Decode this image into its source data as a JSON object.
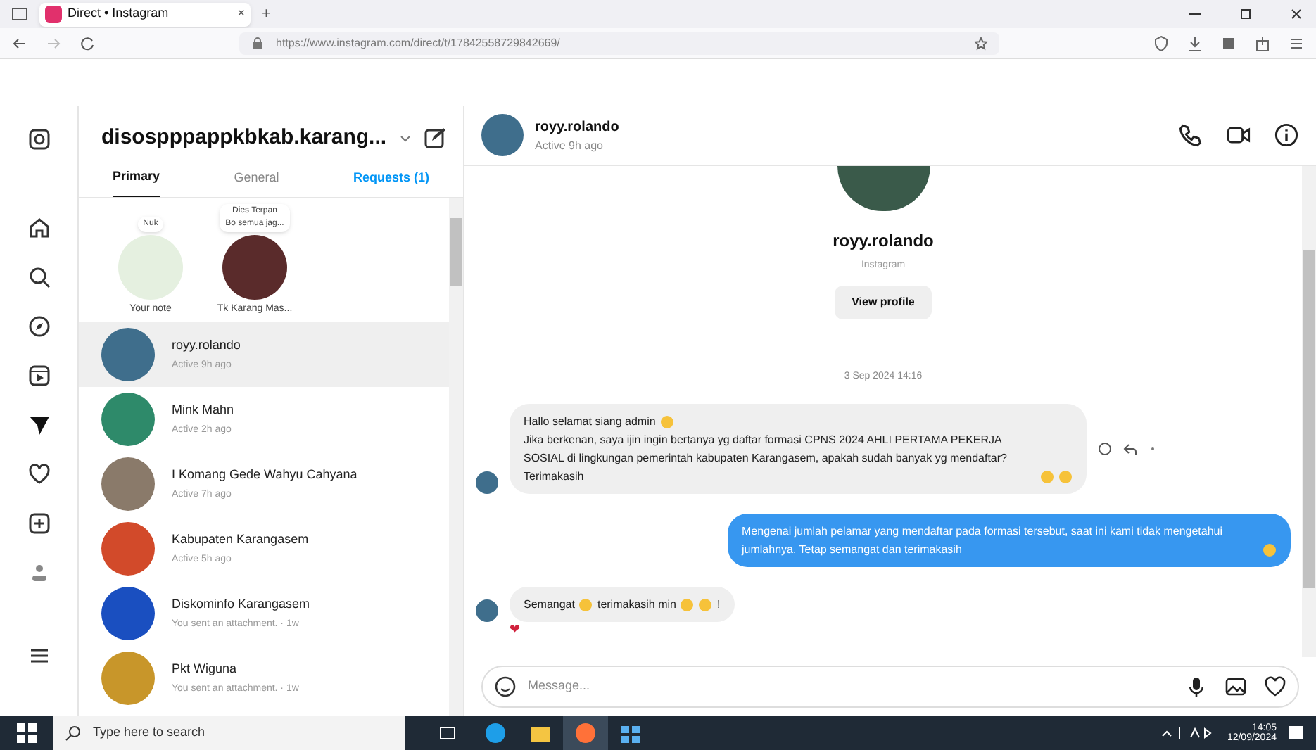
{
  "browser": {
    "tab_title": "Direct • Instagram",
    "tab_close": "×",
    "new_tab": "+",
    "url": "https://www.instagram.com/direct/t/17842558729842669/"
  },
  "account": {
    "username": "disospppappkbkab.karang..."
  },
  "inbox_tabs": [
    {
      "label": "Primary",
      "selected": true,
      "kind": "tab"
    },
    {
      "label": "General",
      "selected": false,
      "kind": "tab"
    },
    {
      "label": "Requests (1)",
      "selected": false,
      "kind": "link"
    }
  ],
  "notes": [
    {
      "label": "Your note",
      "bubble": [
        "Nuk"
      ],
      "color": "#e5f0e0"
    },
    {
      "label": "Tk Karang Mas...",
      "bubble": [
        "Dies Terpan",
        "Bo semua jag..."
      ],
      "color": "#5a2b2b"
    }
  ],
  "threads": [
    {
      "name": "royy.rolando",
      "status": "Active 9h ago",
      "selected": true,
      "color": "#3f6e8c"
    },
    {
      "name": "Mink Mahn",
      "status": "Active 2h ago",
      "selected": false,
      "color": "#2e8a6a"
    },
    {
      "name": "I Komang Gede Wahyu Cahyana",
      "status": "Active 7h ago",
      "selected": false,
      "color": "#8a7a6a"
    },
    {
      "name": "Kabupaten Karangasem",
      "status": "Active 5h ago",
      "selected": false,
      "color": "#d24a2a"
    },
    {
      "name": "Diskominfo Karangasem",
      "status": "You sent an attachment. · 1w",
      "selected": false,
      "color": "#1a4fc0"
    },
    {
      "name": "Pkt Wiguna",
      "status": "You sent an attachment. · 1w",
      "selected": false,
      "color": "#c8962a"
    }
  ],
  "chat": {
    "name": "royy.rolando",
    "status": "Active 9h ago",
    "profile": {
      "name": "royy.rolando",
      "subtitle": "Instagram",
      "button": "View profile"
    },
    "date": "3 Sep 2024 14:16",
    "messages": [
      {
        "kind": "incoming",
        "lines": [
          [
            {
              "kind": "text",
              "text": "Hallo selamat siang admin"
            },
            {
              "kind": "emoji"
            }
          ],
          [
            {
              "kind": "text",
              "text": "Jika berkenan, saya ijin ingin bertanya yg daftar formasi CPNS 2024 AHLI PERTAMA PEKERJA SOSIAL di lingkungan pemerintah kabupaten Karangasem, apakah sudah banyak yg mendaftar? Terimakasih"
            },
            {
              "kind": "emoji"
            },
            {
              "kind": "emoji"
            }
          ]
        ],
        "actions": true
      },
      {
        "kind": "outgoing",
        "lines": [
          [
            {
              "kind": "text",
              "text": "Mengenai jumlah pelamar yang mendaftar pada formasi tersebut, saat ini kami tidak mengetahui jumlahnya. Tetap semangat dan terimakasih"
            },
            {
              "kind": "emoji"
            }
          ]
        ],
        "actions": false
      },
      {
        "kind": "incoming",
        "lines": [
          [
            {
              "kind": "text",
              "text": "Semangat"
            },
            {
              "kind": "emoji"
            },
            {
              "kind": "text",
              "text": "terimakasih min"
            },
            {
              "kind": "emoji"
            },
            {
              "kind": "emoji"
            },
            {
              "kind": "text",
              "text": "!"
            }
          ]
        ],
        "actions": false,
        "reaction": "❤"
      }
    ],
    "input_placeholder": "Message..."
  },
  "taskbar": {
    "search_placeholder": "Type here to search",
    "time": "14:05",
    "date": "12/09/2024"
  }
}
